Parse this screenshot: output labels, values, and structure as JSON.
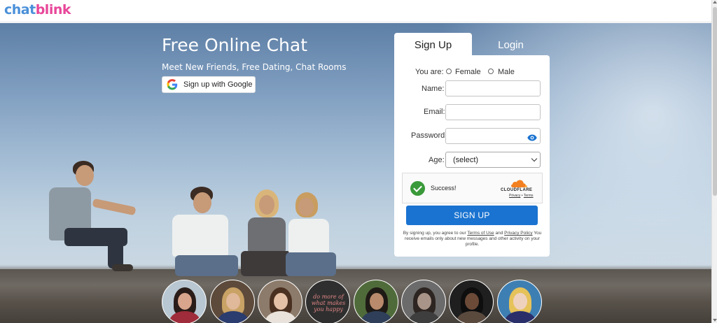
{
  "header": {
    "logo_part1": "chat",
    "logo_part2": "blink"
  },
  "hero": {
    "title": "Free Online Chat",
    "subtitle": "Meet New Friends, Free Dating, Chat Rooms",
    "google_button_label": "Sign up with Google"
  },
  "tabs": {
    "signup": "Sign Up",
    "login": "Login"
  },
  "form": {
    "you_are_label": "You are:",
    "gender_options": [
      "Female",
      "Male"
    ],
    "name_label": "Name:",
    "name_value": "",
    "email_label": "Email:",
    "email_value": "",
    "password_label": "Password:",
    "password_value": "",
    "age_label": "Age:",
    "age_selected": "(select)",
    "submit_label": "SIGN UP"
  },
  "captcha": {
    "status": "Success!",
    "provider": "CLOUDFLARE",
    "privacy": "Privacy",
    "separator": "•",
    "terms": "Terms"
  },
  "terms_notice": {
    "prefix": "By signing up, you agree to our ",
    "terms_link": "Terms of Use",
    "middle": " and ",
    "privacy_link": "Privacy Policy",
    "suffix": " You receive emails only about new messages and other activity on your profile."
  },
  "avatars": {
    "quote_text": "do more of what makes you happy"
  },
  "colors": {
    "logo_blue": "#4a90d9",
    "logo_pink": "#e8479a",
    "button_blue": "#1a73d0",
    "captcha_green": "#3a9a3a",
    "cloudflare_orange": "#f38020"
  },
  "icons": [
    "google-icon",
    "eye-icon",
    "check-icon",
    "cloudflare-cloud-icon",
    "chevron-down-icon"
  ]
}
